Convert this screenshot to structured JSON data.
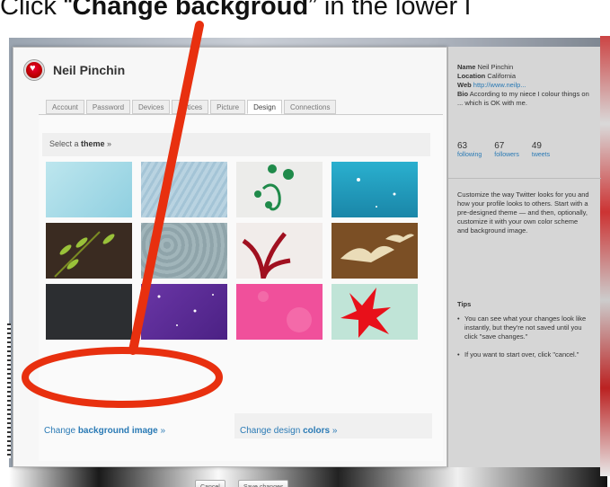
{
  "caption": {
    "prefix": "Click “",
    "bold": "Change backgroud",
    "suffix": "” in the lower l"
  },
  "profile": {
    "name": "Neil Pinchin"
  },
  "tabs": [
    {
      "label": "Account",
      "active": false
    },
    {
      "label": "Password",
      "active": false
    },
    {
      "label": "Devices",
      "active": false
    },
    {
      "label": "Notices",
      "active": false
    },
    {
      "label": "Picture",
      "active": false
    },
    {
      "label": "Design",
      "active": true
    },
    {
      "label": "Connections",
      "active": false
    }
  ],
  "theme_picker": {
    "prefix": "Select a ",
    "bold": "theme",
    "suffix": " »"
  },
  "themes": [
    {
      "name": "light-blue-clouds",
      "color": "#9fd6e3"
    },
    {
      "name": "blue-linen",
      "color": "#a8c7d8"
    },
    {
      "name": "green-flourish",
      "color": "#e9eee9"
    },
    {
      "name": "teal-sparkle",
      "color": "#1f9fc0"
    },
    {
      "name": "brown-leaves",
      "color": "#3b2c22"
    },
    {
      "name": "grey-blue-texture",
      "color": "#8fa5ab"
    },
    {
      "name": "red-plant",
      "color": "#f1eceb"
    },
    {
      "name": "brown-birds",
      "color": "#7a4e24"
    },
    {
      "name": "dark-charcoal",
      "color": "#2b2d30"
    },
    {
      "name": "purple-stars",
      "color": "#5a2c96"
    },
    {
      "name": "pink-bubbles",
      "color": "#f04f9a"
    },
    {
      "name": "red-leaf-mint",
      "color": "#bfe3d6"
    }
  ],
  "links": {
    "background": {
      "prefix": "Change ",
      "bold": "background image",
      "suffix": " »"
    },
    "colors": {
      "prefix": "Change design ",
      "bold": "colors",
      "suffix": " »"
    }
  },
  "buttons": {
    "cancel": "Cancel",
    "save": "Save changes"
  },
  "sidebar": {
    "name_label": "Name",
    "name_value": "Neil Pinchin",
    "location_label": "Location",
    "location_value": "California",
    "web_label": "Web",
    "web_value": "http://www.neilp...",
    "bio_label": "Bio",
    "bio_value": "According to my niece I colour things on ... which is OK with me.",
    "stats": [
      {
        "value": "63",
        "label": "following"
      },
      {
        "value": "67",
        "label": "followers"
      },
      {
        "value": "49",
        "label": "tweets"
      }
    ],
    "help": "Customize the way Twitter looks for you and how your profile looks to others. Start with a pre-designed theme — and then, optionally, customize it with your own color scheme and background image.",
    "tips_title": "Tips",
    "tips": [
      "You can see what your changes look like instantly, but they're not saved until you click \"save changes.\"",
      "If you want to start over, click \"cancel.\""
    ]
  }
}
